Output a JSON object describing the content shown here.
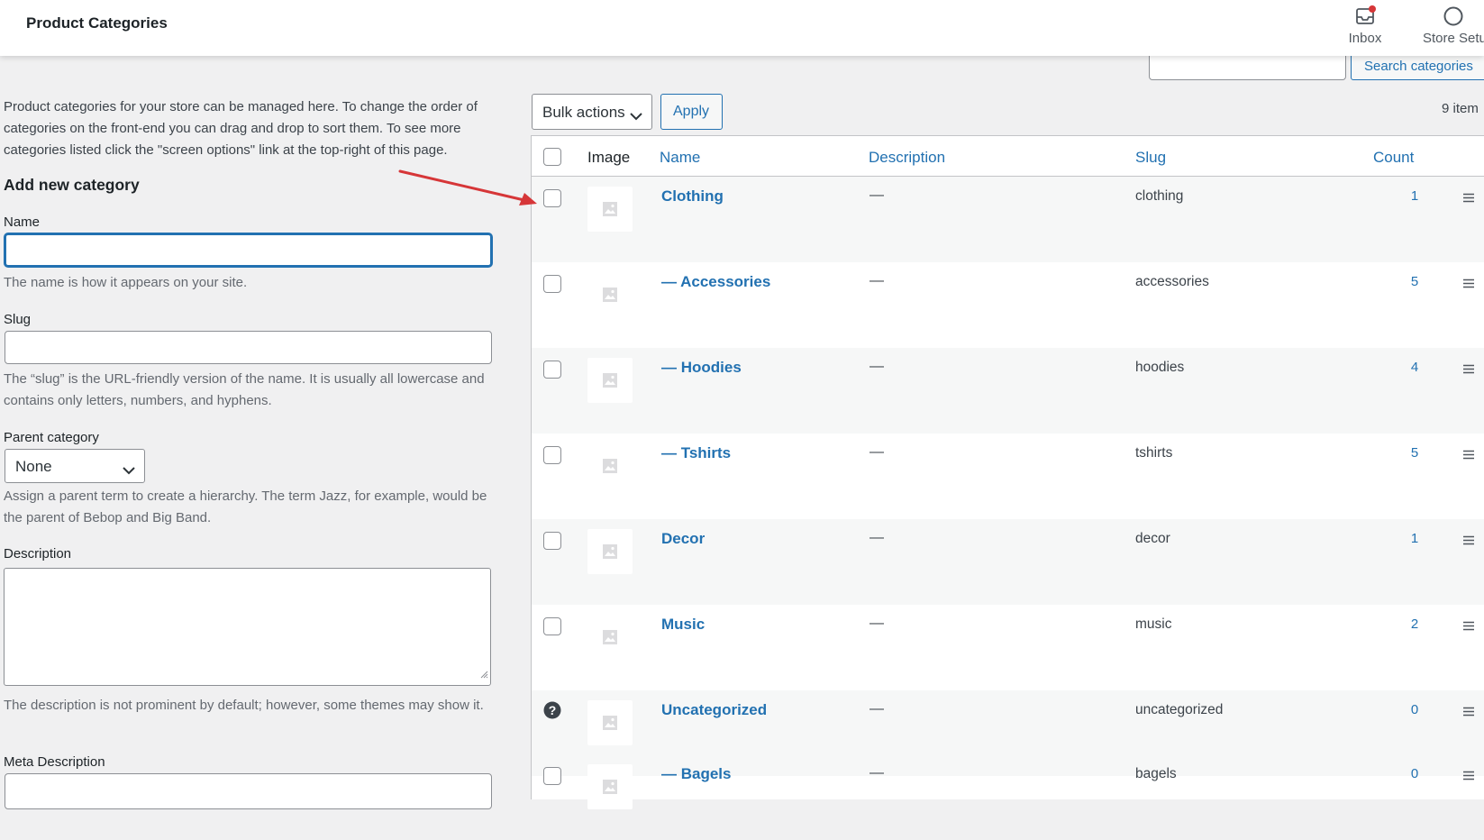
{
  "header": {
    "title": "Product Categories",
    "inbox_label": "Inbox",
    "store_label": "Store Setu"
  },
  "search": {
    "button_label": "Search categories",
    "value": ""
  },
  "form": {
    "intro": "Product categories for your store can be managed here. To change the order of categories on the front-end you can drag and drop to sort them. To see more categories listed click the \"screen options\" link at the top-right of this page.",
    "title": "Add new category",
    "name_label": "Name",
    "name_value": "",
    "name_help": "The name is how it appears on your site.",
    "slug_label": "Slug",
    "slug_value": "",
    "slug_help": "The “slug” is the URL-friendly version of the name. It is usually all lowercase and contains only letters, numbers, and hyphens.",
    "parent_label": "Parent category",
    "parent_value": "None",
    "parent_help": "Assign a parent term to create a hierarchy. The term Jazz, for example, would be the parent of Bebop and Big Band.",
    "desc_label": "Description",
    "desc_help": "The description is not prominent by default; however, some themes may show it.",
    "meta_label": "Meta Description"
  },
  "table": {
    "bulk_label": "Bulk actions",
    "apply_label": "Apply",
    "items_count": "9 item",
    "columns": {
      "image": "Image",
      "name": "Name",
      "description": "Description",
      "slug": "Slug",
      "count": "Count"
    },
    "rows": [
      {
        "name": "Clothing",
        "description": "—",
        "slug": "clothing",
        "count": "1",
        "checkbox": true
      },
      {
        "name": "— Accessories",
        "description": "—",
        "slug": "accessories",
        "count": "5",
        "checkbox": true
      },
      {
        "name": "— Hoodies",
        "description": "—",
        "slug": "hoodies",
        "count": "4",
        "checkbox": true
      },
      {
        "name": "— Tshirts",
        "description": "—",
        "slug": "tshirts",
        "count": "5",
        "checkbox": true
      },
      {
        "name": "Decor",
        "description": "—",
        "slug": "decor",
        "count": "1",
        "checkbox": true
      },
      {
        "name": "Music",
        "description": "—",
        "slug": "music",
        "count": "2",
        "checkbox": true
      },
      {
        "name": "Uncategorized",
        "description": "—",
        "slug": "uncategorized",
        "count": "0",
        "checkbox": false
      },
      {
        "name": "— Bagels",
        "description": "—",
        "slug": "bagels",
        "count": "0",
        "checkbox": true
      }
    ]
  },
  "colors": {
    "link": "#2271b1",
    "annotation_arrow": "#d63638",
    "notification_dot": "#d63638"
  },
  "icons": [
    "inbox-icon",
    "store-setup-icon",
    "chevron-down-icon",
    "image-placeholder-icon",
    "help-icon",
    "drag-handle-icon",
    "annotation-arrow"
  ]
}
